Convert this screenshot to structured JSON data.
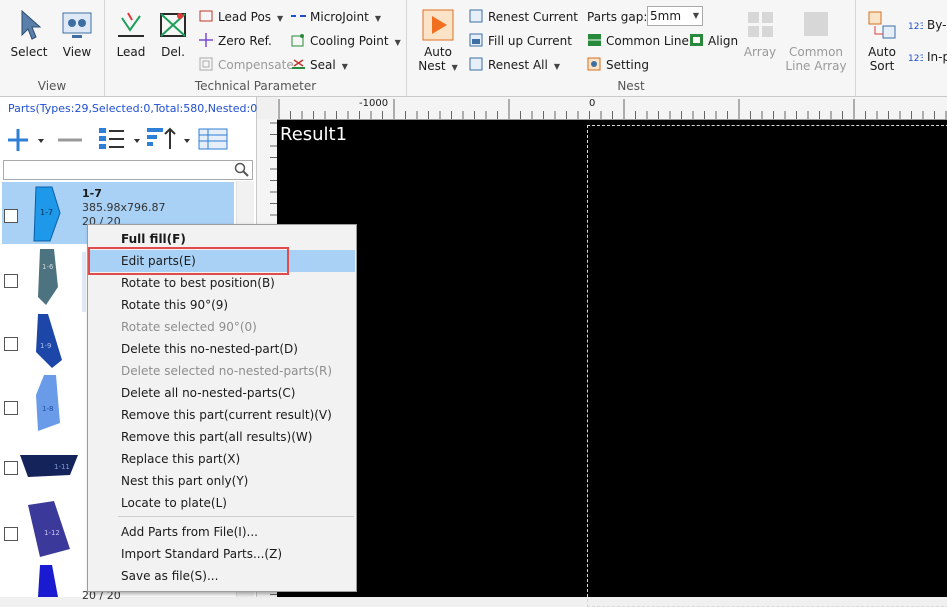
{
  "ribbon": {
    "view_group": {
      "title": "View",
      "select": "Select",
      "view": "View"
    },
    "tech_group": {
      "title": "Technical Parameter",
      "lead": "Lead",
      "del": "Del.",
      "lead_pos": "Lead Pos",
      "zero_ref": "Zero Ref.",
      "compensate": "Compensate",
      "microjoint": "MicroJoint",
      "cooling_point": "Cooling Point",
      "seal": "Seal"
    },
    "nest_group": {
      "title": "Nest",
      "auto_nest_1": "Auto",
      "auto_nest_2": "Nest",
      "renest_current": "Renest Current",
      "fill_up_current": "Fill up Current",
      "renest_all": "Renest All",
      "parts_gap_label": "Parts gap:",
      "parts_gap_value": "5mm",
      "common_line": "Common Line",
      "align": "Align",
      "setting": "Setting",
      "array": "Array",
      "common_line_array_1": "Common",
      "common_line_array_2": "Line Array"
    },
    "sort_group": {
      "auto_sort_1": "Auto",
      "auto_sort_2": "Sort",
      "by_label": "By-p",
      "in_label": "In-p"
    }
  },
  "parts_panel": {
    "stats": "Parts(Types:29,Selected:0,Total:580,Nested:0)",
    "selected_part": {
      "name": "1-7",
      "dims": "385.98x796.87",
      "count": "20 / 20",
      "tag": "1-7"
    },
    "other_tags": [
      "1-6",
      "1-9",
      "1-8",
      "1-11",
      "1-12"
    ],
    "last_count": "20 / 20"
  },
  "canvas": {
    "title": "Result1",
    "ruler_labels": [
      "-1000",
      "0"
    ]
  },
  "context_menu": {
    "items": [
      {
        "label": "Full fill(F)",
        "state": "bold"
      },
      {
        "label": "Edit parts(E)",
        "state": "highlighted"
      },
      {
        "label": "Rotate to best position(B)",
        "state": "normal"
      },
      {
        "label": "Rotate this 90°(9)",
        "state": "normal"
      },
      {
        "label": "Rotate selected 90°(0)",
        "state": "disabled"
      },
      {
        "label": "Delete this no-nested-part(D)",
        "state": "normal"
      },
      {
        "label": "Delete selected no-nested-parts(R)",
        "state": "disabled"
      },
      {
        "label": "Delete all no-nested-parts(C)",
        "state": "normal"
      },
      {
        "label": "Remove this part(current result)(V)",
        "state": "normal"
      },
      {
        "label": "Remove this part(all results)(W)",
        "state": "normal"
      },
      {
        "label": "Replace this part(X)",
        "state": "normal"
      },
      {
        "label": "Nest this part only(Y)",
        "state": "normal"
      },
      {
        "label": "Locate to plate(L)",
        "state": "normal"
      },
      {
        "label": "Add Parts from File(I)...",
        "state": "normal"
      },
      {
        "label": "Import Standard Parts...(Z)",
        "state": "normal"
      },
      {
        "label": "Save as file(S)...",
        "state": "normal"
      }
    ]
  },
  "colors": {
    "selection": "#a9d1f5",
    "highlight_border": "#e14b4b",
    "stats_text": "#1f4fd0",
    "canvas_bg": "#000000"
  }
}
